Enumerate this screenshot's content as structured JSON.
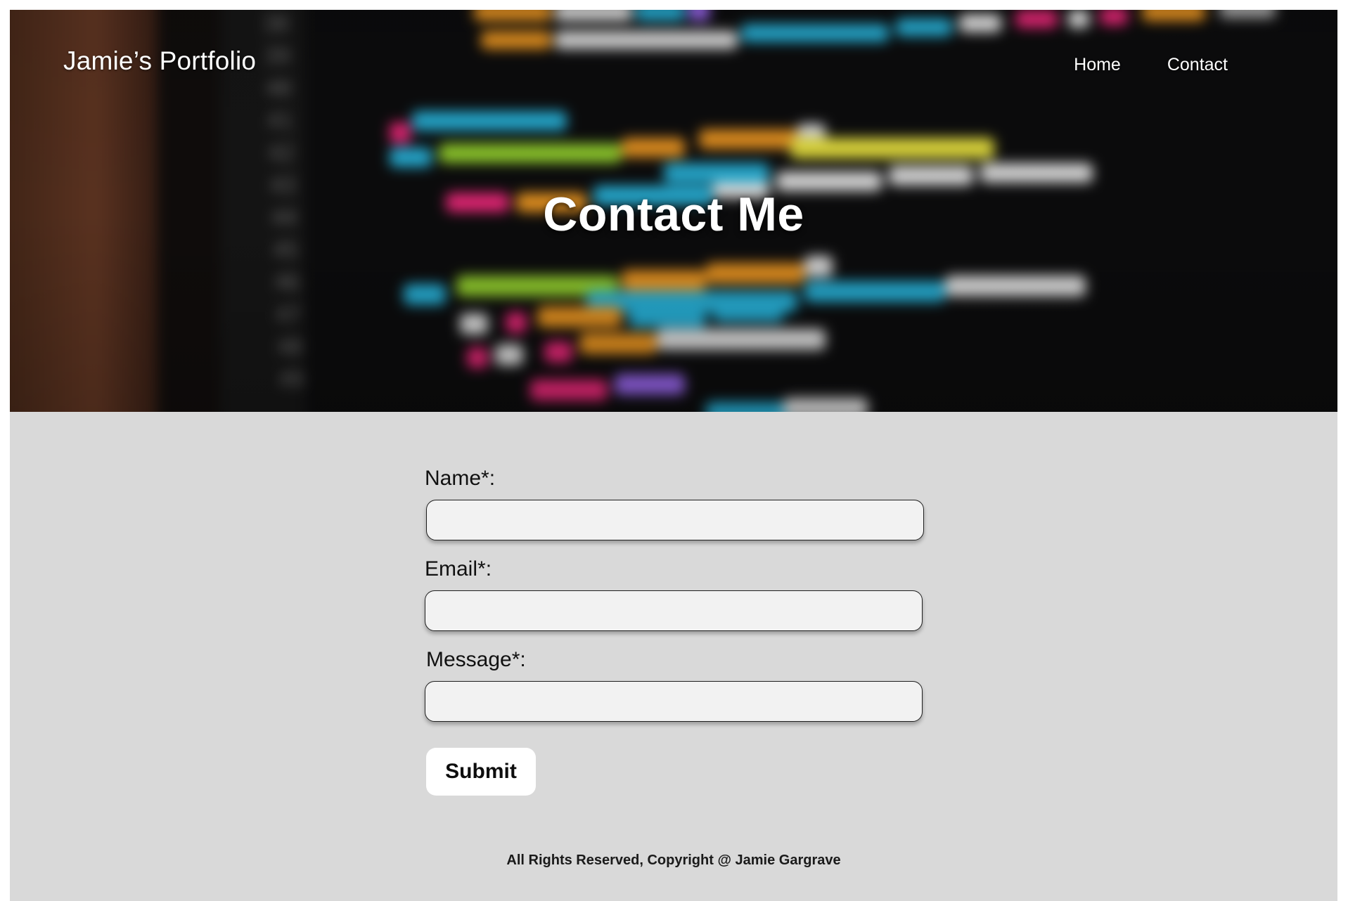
{
  "header": {
    "brand": "Jamie’s Portfolio",
    "nav": [
      {
        "label": "Home"
      },
      {
        "label": "Contact"
      }
    ]
  },
  "hero": {
    "title": "Contact Me",
    "background": "blurred-code-editor-image"
  },
  "form": {
    "name_label": "Name*:",
    "name_value": "",
    "email_label": "Email*:",
    "email_value": "",
    "message_label": "Message*:",
    "message_value": "",
    "submit_label": "Submit"
  },
  "footer": {
    "text": "All Rights Reserved, Copyright @ Jamie Gargrave"
  },
  "colors": {
    "page_bg": "#d9d9d9",
    "field_bg": "#f2f2f2",
    "field_border": "#1f1f1f",
    "button_bg": "#ffffff",
    "hero_text": "#ffffff"
  }
}
